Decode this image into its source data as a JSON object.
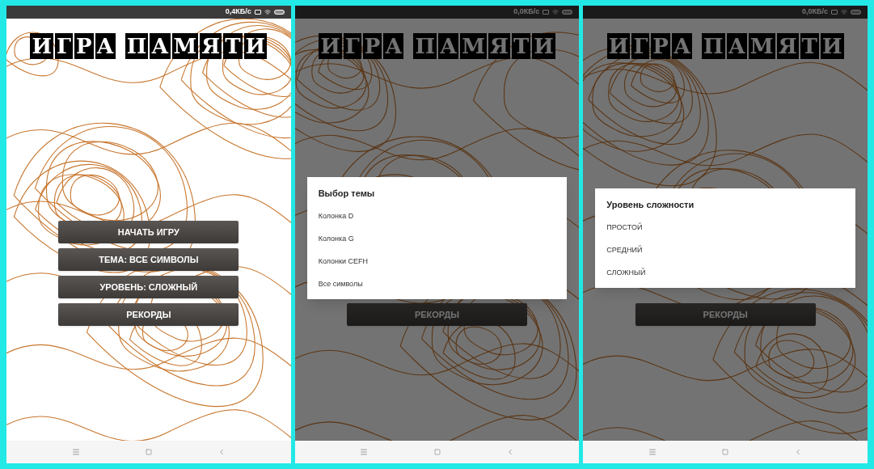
{
  "screens": [
    {
      "status_bar": {
        "speed": "0,4КБ/с"
      },
      "title": "ИГРА ПАМЯТИ",
      "dimmed": false,
      "menu_buttons": [
        "НАЧАТЬ ИГРУ",
        "ТЕМА: ВСЕ СИМВОЛЫ",
        "УРОВЕНЬ: СЛОЖНЫЙ",
        "РЕКОРДЫ"
      ]
    },
    {
      "status_bar": {
        "speed": "0,0КБ/с"
      },
      "title": "ИГРА ПАМЯТИ",
      "dimmed": true,
      "menu_buttons": [
        "РЕКОРДЫ"
      ],
      "dialog": {
        "title": "Выбор темы",
        "options": [
          "Колонка D",
          "Колонка G",
          "Колонки CEFH",
          "Все символы"
        ]
      }
    },
    {
      "status_bar": {
        "speed": "0,0КБ/с"
      },
      "title": "ИГРА ПАМЯТИ",
      "dimmed": true,
      "menu_buttons": [
        "РЕКОРДЫ"
      ],
      "dialog": {
        "title": "Уровень сложности",
        "options": [
          "ПРОСТОЙ",
          "СРЕДНИЙ",
          "СЛОЖНЫЙ"
        ]
      }
    }
  ]
}
